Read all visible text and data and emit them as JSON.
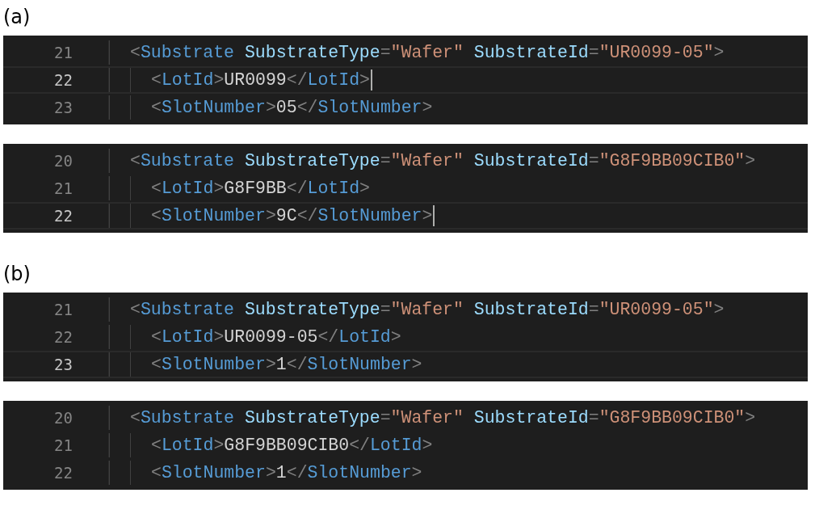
{
  "figures": [
    {
      "label": "(a)",
      "panels": [
        {
          "lines": [
            {
              "number": "21",
              "kind": "parent",
              "current": false,
              "cursor": false,
              "tokens": [
                {
                  "kind": "punct",
                  "text": "<"
                },
                {
                  "kind": "tag",
                  "text": "Substrate"
                },
                {
                  "kind": "attr",
                  "text": " SubstrateType"
                },
                {
                  "kind": "punct",
                  "text": "="
                },
                {
                  "kind": "string",
                  "text": "\"Wafer\""
                },
                {
                  "kind": "attr",
                  "text": " SubstrateId"
                },
                {
                  "kind": "punct",
                  "text": "="
                },
                {
                  "kind": "string",
                  "text": "\"UR0099-05\""
                },
                {
                  "kind": "punct",
                  "text": ">"
                }
              ]
            },
            {
              "number": "22",
              "kind": "child",
              "current": true,
              "cursor": true,
              "tokens": [
                {
                  "kind": "punct",
                  "text": "<"
                },
                {
                  "kind": "tag",
                  "text": "LotId"
                },
                {
                  "kind": "punct",
                  "text": ">"
                },
                {
                  "kind": "text",
                  "text": "UR0099"
                },
                {
                  "kind": "punct",
                  "text": "</"
                },
                {
                  "kind": "tag",
                  "text": "LotId"
                },
                {
                  "kind": "punct",
                  "text": ">"
                }
              ]
            },
            {
              "number": "23",
              "kind": "child",
              "current": false,
              "cursor": false,
              "tokens": [
                {
                  "kind": "punct",
                  "text": "<"
                },
                {
                  "kind": "tag",
                  "text": "SlotNumber"
                },
                {
                  "kind": "punct",
                  "text": ">"
                },
                {
                  "kind": "text",
                  "text": "05"
                },
                {
                  "kind": "punct",
                  "text": "</"
                },
                {
                  "kind": "tag",
                  "text": "SlotNumber"
                },
                {
                  "kind": "punct",
                  "text": ">"
                }
              ]
            }
          ]
        },
        {
          "lines": [
            {
              "number": "20",
              "kind": "parent",
              "current": false,
              "cursor": false,
              "tokens": [
                {
                  "kind": "punct",
                  "text": "<"
                },
                {
                  "kind": "tag",
                  "text": "Substrate"
                },
                {
                  "kind": "attr",
                  "text": " SubstrateType"
                },
                {
                  "kind": "punct",
                  "text": "="
                },
                {
                  "kind": "string",
                  "text": "\"Wafer\""
                },
                {
                  "kind": "attr",
                  "text": " SubstrateId"
                },
                {
                  "kind": "punct",
                  "text": "="
                },
                {
                  "kind": "string",
                  "text": "\"G8F9BB09CIB0\""
                },
                {
                  "kind": "punct",
                  "text": ">"
                }
              ]
            },
            {
              "number": "21",
              "kind": "child",
              "current": false,
              "cursor": false,
              "tokens": [
                {
                  "kind": "punct",
                  "text": "<"
                },
                {
                  "kind": "tag",
                  "text": "LotId"
                },
                {
                  "kind": "punct",
                  "text": ">"
                },
                {
                  "kind": "text",
                  "text": "G8F9BB"
                },
                {
                  "kind": "punct",
                  "text": "</"
                },
                {
                  "kind": "tag",
                  "text": "LotId"
                },
                {
                  "kind": "punct",
                  "text": ">"
                }
              ]
            },
            {
              "number": "22",
              "kind": "child",
              "current": true,
              "cursor": true,
              "tokens": [
                {
                  "kind": "punct",
                  "text": "<"
                },
                {
                  "kind": "tag",
                  "text": "SlotNumber"
                },
                {
                  "kind": "punct",
                  "text": ">"
                },
                {
                  "kind": "text",
                  "text": "9C"
                },
                {
                  "kind": "punct",
                  "text": "</"
                },
                {
                  "kind": "tag",
                  "text": "SlotNumber"
                },
                {
                  "kind": "punct",
                  "text": ">"
                }
              ]
            }
          ]
        }
      ]
    },
    {
      "label": "(b)",
      "panels": [
        {
          "lines": [
            {
              "number": "21",
              "kind": "parent",
              "current": false,
              "cursor": false,
              "tokens": [
                {
                  "kind": "punct",
                  "text": "<"
                },
                {
                  "kind": "tag",
                  "text": "Substrate"
                },
                {
                  "kind": "attr",
                  "text": " SubstrateType"
                },
                {
                  "kind": "punct",
                  "text": "="
                },
                {
                  "kind": "string",
                  "text": "\"Wafer\""
                },
                {
                  "kind": "attr",
                  "text": " SubstrateId"
                },
                {
                  "kind": "punct",
                  "text": "="
                },
                {
                  "kind": "string",
                  "text": "\"UR0099-05\""
                },
                {
                  "kind": "punct",
                  "text": ">"
                }
              ]
            },
            {
              "number": "22",
              "kind": "child",
              "current": false,
              "cursor": false,
              "tokens": [
                {
                  "kind": "punct",
                  "text": "<"
                },
                {
                  "kind": "tag",
                  "text": "LotId"
                },
                {
                  "kind": "punct",
                  "text": ">"
                },
                {
                  "kind": "text",
                  "text": "UR0099-05"
                },
                {
                  "kind": "punct",
                  "text": "</"
                },
                {
                  "kind": "tag",
                  "text": "LotId"
                },
                {
                  "kind": "punct",
                  "text": ">"
                }
              ]
            },
            {
              "number": "23",
              "kind": "child",
              "current": true,
              "cursor": false,
              "tokens": [
                {
                  "kind": "punct",
                  "text": "<"
                },
                {
                  "kind": "tag",
                  "text": "SlotNumber"
                },
                {
                  "kind": "punct",
                  "text": ">"
                },
                {
                  "kind": "text",
                  "text": "1"
                },
                {
                  "kind": "punct",
                  "text": "</"
                },
                {
                  "kind": "tag",
                  "text": "SlotNumber"
                },
                {
                  "kind": "punct",
                  "text": ">"
                }
              ]
            }
          ]
        },
        {
          "lines": [
            {
              "number": "20",
              "kind": "parent",
              "current": false,
              "cursor": false,
              "tokens": [
                {
                  "kind": "punct",
                  "text": "<"
                },
                {
                  "kind": "tag",
                  "text": "Substrate"
                },
                {
                  "kind": "attr",
                  "text": " SubstrateType"
                },
                {
                  "kind": "punct",
                  "text": "="
                },
                {
                  "kind": "string",
                  "text": "\"Wafer\""
                },
                {
                  "kind": "attr",
                  "text": " SubstrateId"
                },
                {
                  "kind": "punct",
                  "text": "="
                },
                {
                  "kind": "string",
                  "text": "\"G8F9BB09CIB0\""
                },
                {
                  "kind": "punct",
                  "text": ">"
                }
              ]
            },
            {
              "number": "21",
              "kind": "child",
              "current": false,
              "cursor": false,
              "tokens": [
                {
                  "kind": "punct",
                  "text": "<"
                },
                {
                  "kind": "tag",
                  "text": "LotId"
                },
                {
                  "kind": "punct",
                  "text": ">"
                },
                {
                  "kind": "text",
                  "text": "G8F9BB09CIB0"
                },
                {
                  "kind": "punct",
                  "text": "</"
                },
                {
                  "kind": "tag",
                  "text": "LotId"
                },
                {
                  "kind": "punct",
                  "text": ">"
                }
              ]
            },
            {
              "number": "22",
              "kind": "child",
              "current": false,
              "cursor": false,
              "tokens": [
                {
                  "kind": "punct",
                  "text": "<"
                },
                {
                  "kind": "tag",
                  "text": "SlotNumber"
                },
                {
                  "kind": "punct",
                  "text": ">"
                },
                {
                  "kind": "text",
                  "text": "1"
                },
                {
                  "kind": "punct",
                  "text": "</"
                },
                {
                  "kind": "tag",
                  "text": "SlotNumber"
                },
                {
                  "kind": "punct",
                  "text": ">"
                }
              ]
            }
          ]
        }
      ]
    }
  ]
}
